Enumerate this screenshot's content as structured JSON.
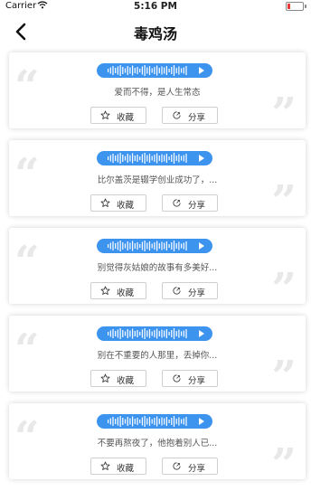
{
  "status_bar": {
    "carrier": "Carrier",
    "time": "5:16 PM",
    "battery_color": "#e53935"
  },
  "nav": {
    "title": "毒鸡汤",
    "back_icon": "chevron-left-icon"
  },
  "colors": {
    "accent": "#3d94ef",
    "quote_mark": "#e8e8e8"
  },
  "cards": [
    {
      "text": "爱而不得，是人生常态",
      "fav_label": "收藏",
      "share_label": "分享"
    },
    {
      "text": "比尔盖茨是辍学创业成功了，...",
      "fav_label": "收藏",
      "share_label": "分享"
    },
    {
      "text": "别觉得灰姑娘的故事有多美好...",
      "fav_label": "收藏",
      "share_label": "分享"
    },
    {
      "text": "别在不重要的人那里，丢掉你...",
      "fav_label": "收藏",
      "share_label": "分享"
    },
    {
      "text": "不要再熬夜了，他抱着别人已...",
      "fav_label": "收藏",
      "share_label": "分享"
    }
  ]
}
